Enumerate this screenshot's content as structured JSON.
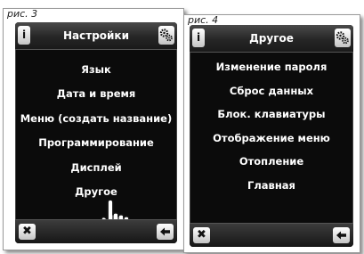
{
  "figure3": {
    "label": "рис. 3",
    "header": {
      "info_icon": "i",
      "title": "Настройки",
      "settings_icon": "gears-icon"
    },
    "menu": [
      "Язык",
      "Дата и время",
      "Меню (создать название)",
      "Программирование",
      "Дисплей",
      "Другое"
    ],
    "footer": {
      "close_icon": "✖",
      "back_icon": "arrow-left-icon"
    }
  },
  "figure4": {
    "label": "рис. 4",
    "header": {
      "info_icon": "i",
      "title": "Другое",
      "settings_icon": "gears-icon"
    },
    "menu": [
      "Изменение пароля",
      "Сброс данных",
      "Блок. клавиатуры",
      "Отображение меню",
      "Отопление",
      "Главная"
    ],
    "footer": {
      "close_icon": "✖",
      "back_icon": "arrow-left-icon"
    }
  }
}
